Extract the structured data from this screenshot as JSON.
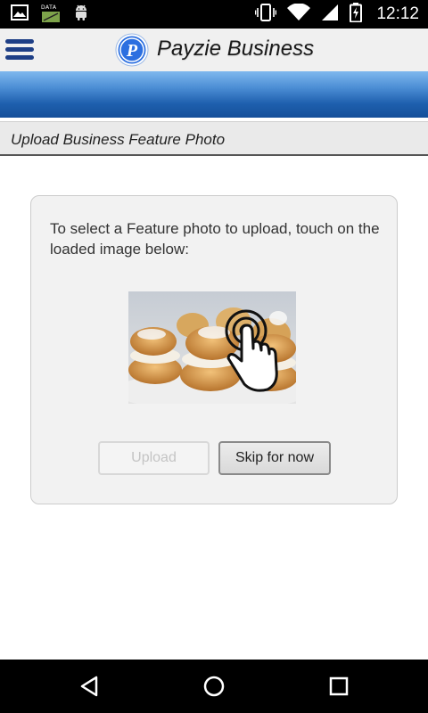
{
  "status_bar": {
    "time": "12:12",
    "data_label": "DATA",
    "icons": [
      "gallery-icon",
      "data-icon",
      "android-icon",
      "vibrate-icon",
      "wifi-icon",
      "signal-icon",
      "battery-charging-icon"
    ]
  },
  "header": {
    "title": "Payzie Business",
    "logo_letter": "P",
    "menu_icon": "hamburger-menu-icon",
    "brand_color": "#1e3f86"
  },
  "section": {
    "title": "Upload Business Feature Photo"
  },
  "card": {
    "instructions": "To select a Feature photo to upload, touch on the loaded image below:",
    "photo_icon": "tap-gesture-icon",
    "upload_label": "Upload",
    "skip_label": "Skip for now"
  },
  "nav_bar": {
    "icons": [
      "back-icon",
      "home-icon",
      "recents-icon"
    ]
  },
  "colors": {
    "banner_top": "#7fb8ee",
    "banner_bottom": "#154f99",
    "card_bg": "#f2f2f2"
  }
}
